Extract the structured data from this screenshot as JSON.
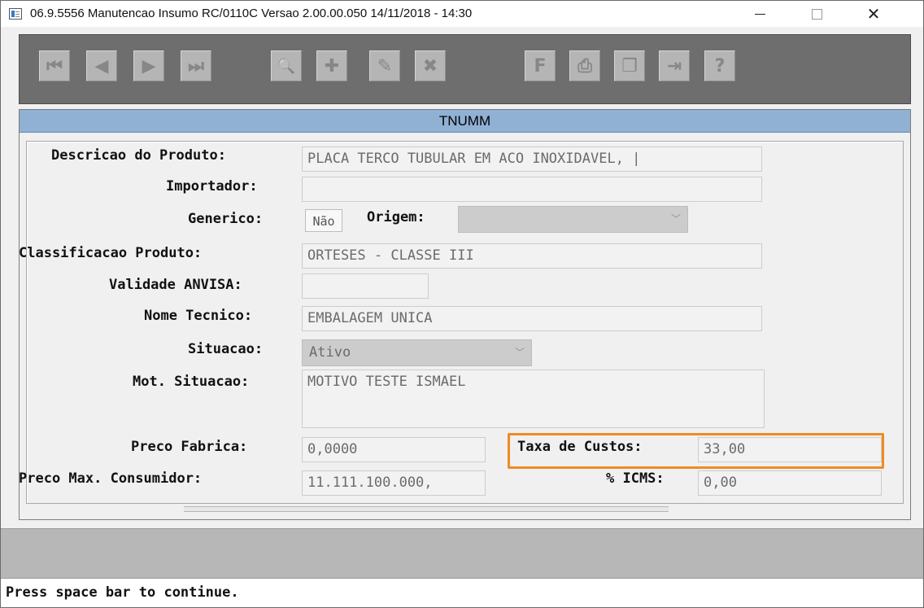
{
  "window": {
    "title": "06.9.5556 Manutencao  Insumo RC/0110C Versao 2.00.00.050 14/11/2018 - 14:30",
    "minimize_label": "—",
    "maximize_label": "☐",
    "close_label": "✕"
  },
  "toolbar": {
    "first_glyph": "⏮",
    "prev_glyph": "◀",
    "next_glyph": "▶",
    "last_glyph": "⏭",
    "search_glyph": "🔍",
    "add_glyph": "✚",
    "edit_glyph": "✎",
    "delete_glyph": "✖",
    "filter_glyph": "F",
    "print_glyph": "⎙",
    "copy_glyph": "❐",
    "exit_glyph": "⇥",
    "help_glyph": "?"
  },
  "form": {
    "header": "TNUMM",
    "fields": {
      "descricao_label": "Descricao do Produto:",
      "descricao_value": "PLACA TERCO TUBULAR EM ACO INOXIDAVEL, |",
      "importador_label": "Importador:",
      "importador_value": "",
      "generico_label": "Generico:",
      "generico_value": "Não",
      "origem_label": "Origem:",
      "origem_value": "",
      "classificacao_label": "Classificacao Produto:",
      "classificacao_value": "ORTESES - CLASSE III",
      "validade_label": "Validade ANVISA:",
      "validade_value": "",
      "nome_tecnico_label": "Nome Tecnico:",
      "nome_tecnico_value": "EMBALAGEM UNICA",
      "situacao_label": "Situacao:",
      "situacao_value": "Ativo",
      "mot_situacao_label": "Mot. Situacao:",
      "mot_situacao_value": "MOTIVO TESTE ISMAEL",
      "preco_fabrica_label": "Preco Fabrica:",
      "preco_fabrica_value": "0,0000",
      "taxa_custos_label": "Taxa de Custos:",
      "taxa_custos_value": "33,00",
      "preco_max_label": "Preco Max. Consumidor:",
      "preco_max_value": "11.111.100.000,",
      "icms_label": "% ICMS:",
      "icms_value": "0,00"
    }
  },
  "status": {
    "message": "Press space bar to continue."
  },
  "colors": {
    "header_bg": "#90b0d4",
    "highlight_border": "#f08a24",
    "toolbar_bg": "#6e6e6e",
    "button_bg": "#b5b5b5"
  }
}
